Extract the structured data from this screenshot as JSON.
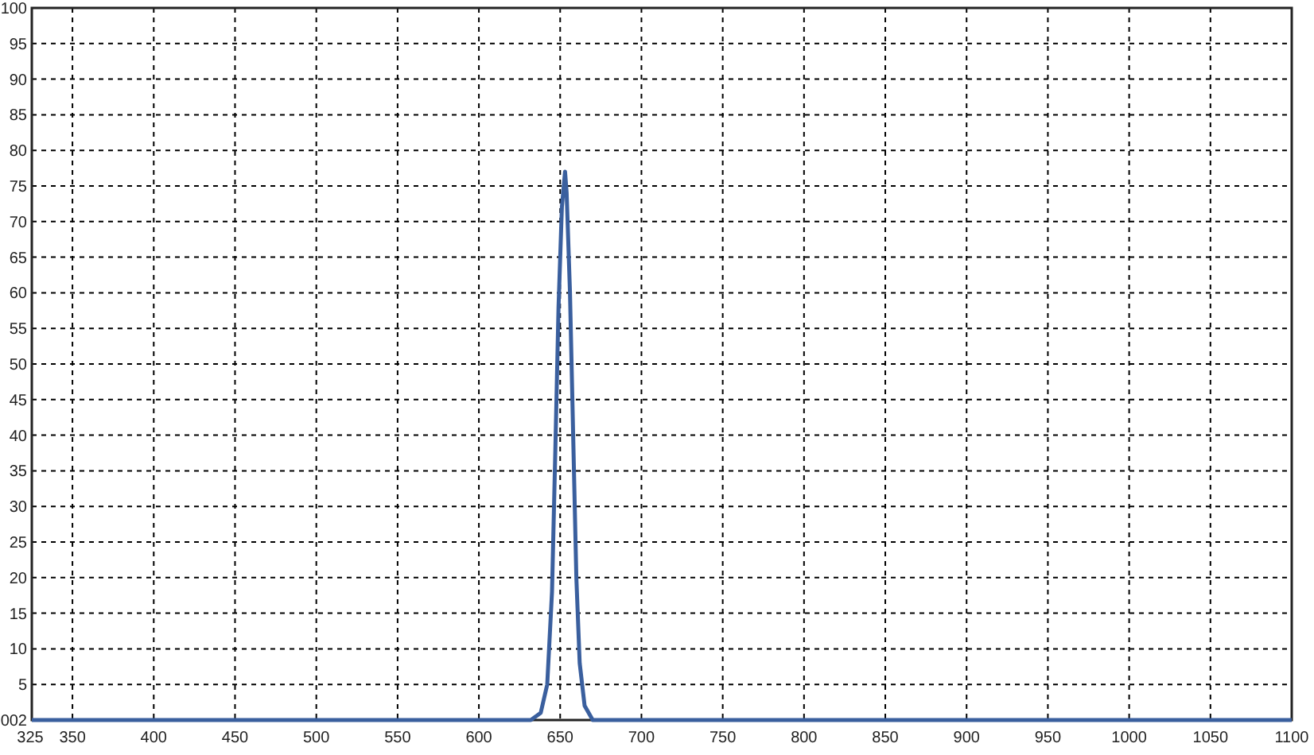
{
  "chart_data": {
    "type": "line",
    "grid": true,
    "xlim": [
      325,
      1100
    ],
    "ylim": [
      0,
      100
    ],
    "xticks": [
      325,
      350,
      400,
      450,
      500,
      550,
      600,
      650,
      700,
      750,
      800,
      850,
      900,
      950,
      1000,
      1050,
      1100
    ],
    "yticks": [
      5,
      10,
      15,
      20,
      25,
      30,
      35,
      40,
      45,
      50,
      55,
      60,
      65,
      70,
      75,
      80,
      85,
      90,
      95,
      100
    ],
    "x": [
      325,
      600,
      632,
      638,
      642,
      645,
      647,
      649,
      651,
      653,
      654,
      656,
      658,
      660,
      662,
      665,
      670,
      700,
      1100
    ],
    "series": [
      {
        "color": "#3a5f9e",
        "values": [
          0,
          0,
          0,
          1,
          5,
          18,
          38,
          58,
          72,
          77,
          74,
          60,
          40,
          20,
          8,
          2,
          0,
          0,
          0
        ]
      }
    ]
  },
  "corner_label": "002"
}
